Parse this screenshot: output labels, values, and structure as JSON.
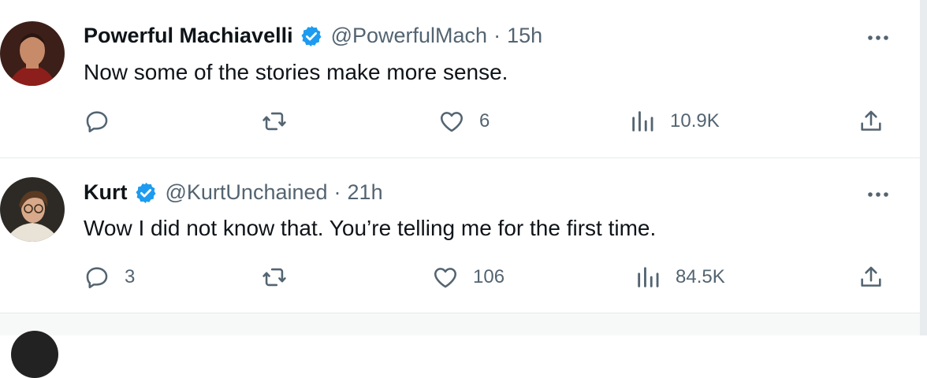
{
  "colors": {
    "text": "#0f1419",
    "muted": "#536471",
    "verified": "#1d9bf0",
    "divider": "#e6e9eb"
  },
  "tweets": [
    {
      "name": "Powerful Machiavelli",
      "handle": "@PowerfulMach",
      "separator": "·",
      "time": "15h",
      "text": "Now some of the stories make more sense.",
      "reply_count": "",
      "retweet_count": "",
      "like_count": "6",
      "view_count": "10.9K",
      "avatar_icon": "portrait-avatar"
    },
    {
      "name": "Kurt",
      "handle": "@KurtUnchained",
      "separator": "·",
      "time": "21h",
      "text": "Wow I did not know that. You’re telling me for the first time.",
      "reply_count": "3",
      "retweet_count": "",
      "like_count": "106",
      "view_count": "84.5K",
      "avatar_icon": "photo-avatar"
    }
  ]
}
